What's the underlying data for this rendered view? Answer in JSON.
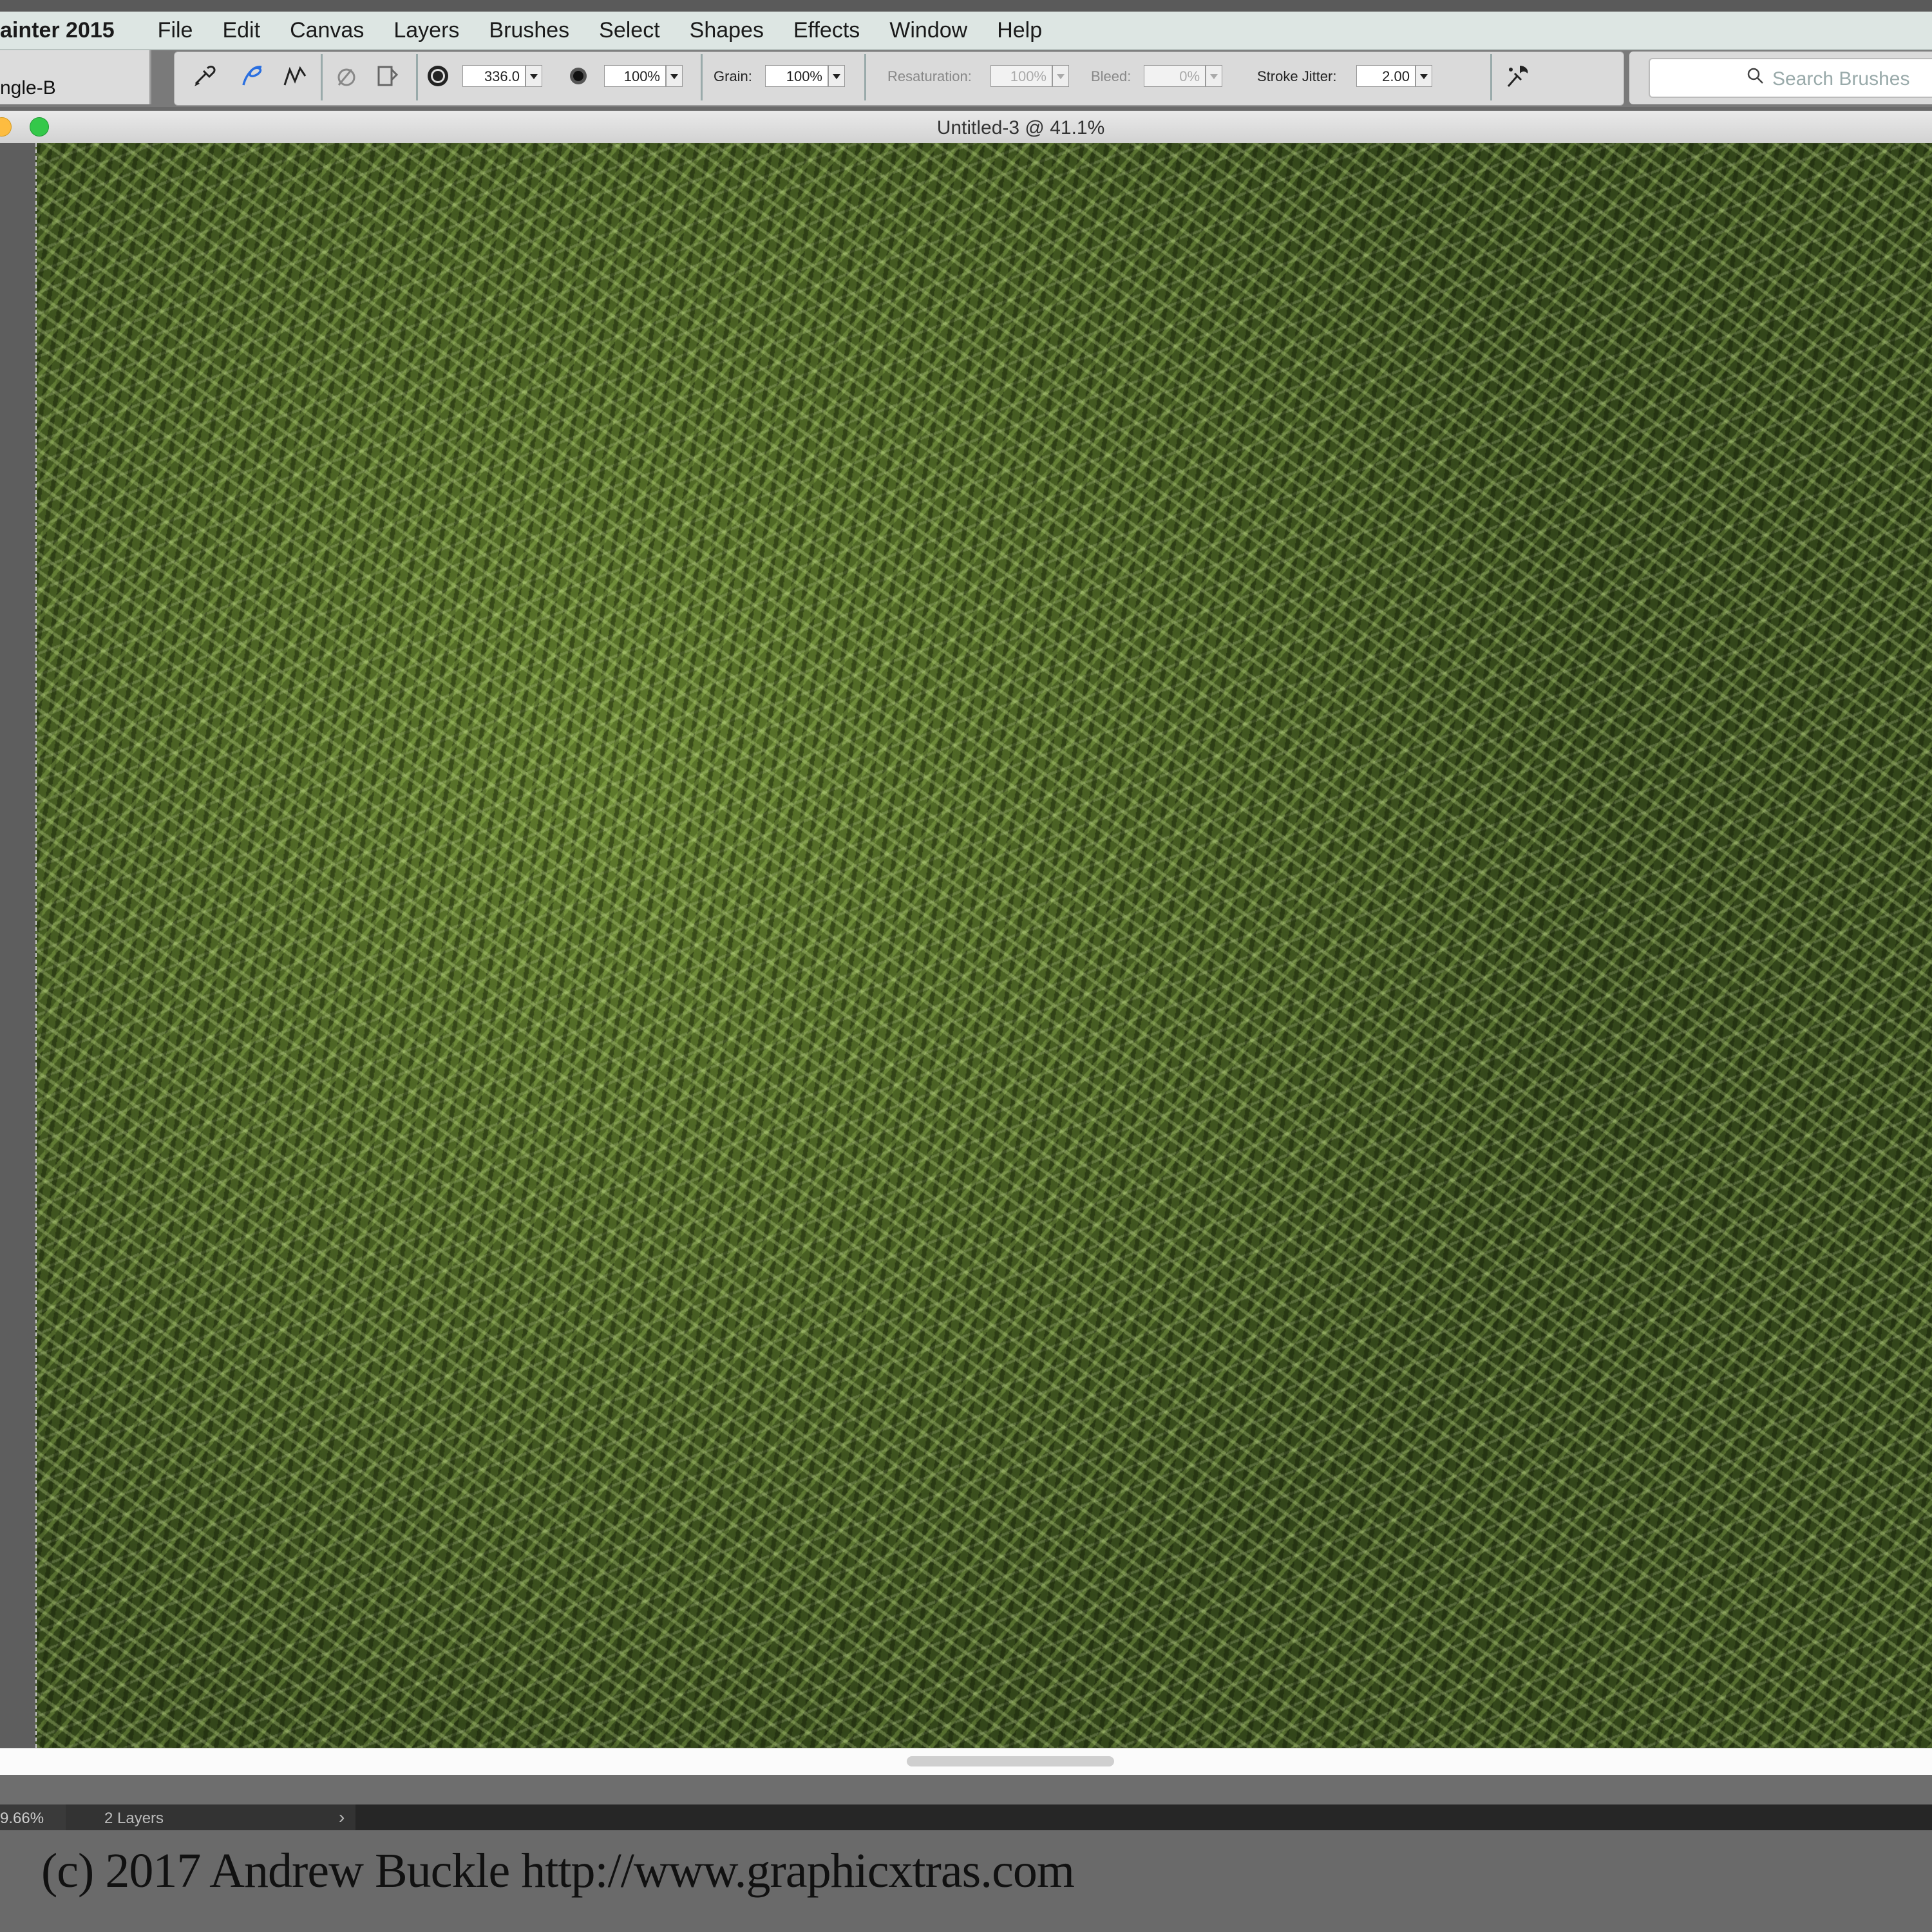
{
  "app": {
    "name": "ainter 2015"
  },
  "menu": [
    "File",
    "Edit",
    "Canvas",
    "Layers",
    "Brushes",
    "Select",
    "Shapes",
    "Effects",
    "Window",
    "Help"
  ],
  "brush": {
    "variant": "ngle-B"
  },
  "propbar": {
    "size_value": "336.0",
    "opacity_value": "100%",
    "grain_label": "Grain:",
    "grain_value": "100%",
    "resaturation_label": "Resaturation:",
    "resaturation_value": "100%",
    "bleed_label": "Bleed:",
    "bleed_value": "0%",
    "jitter_label": "Stroke Jitter:",
    "jitter_value": "2.00"
  },
  "search": {
    "placeholder": "Search Brushes"
  },
  "document": {
    "title": "Untitled-3 @ 41.1%"
  },
  "status": {
    "zoom": "9.66%",
    "layers": "2 Layers"
  },
  "footer": {
    "copyright": "(c) 2017 Andrew Buckle http://www.graphicxtras.com"
  },
  "colors": {
    "canvas_texture": "#4a6322",
    "menubar": "#dde6e3",
    "traffic_close": "#fdbc40",
    "traffic_zoom": "#34c84a"
  },
  "icons": [
    "brush-tool-icon",
    "freehand-stroke-icon",
    "straight-line-stroke-icon",
    "reset-tool-icon",
    "dab-type-icon",
    "size-icon",
    "opacity-icon",
    "brush-tracking-icon",
    "search-icon",
    "chevron-right-icon"
  ]
}
